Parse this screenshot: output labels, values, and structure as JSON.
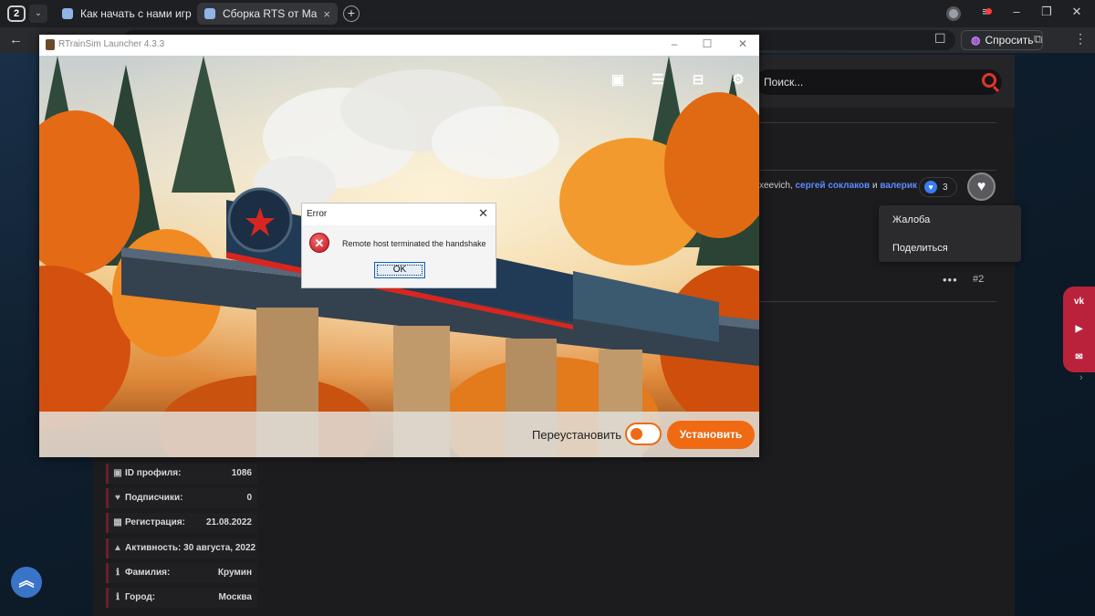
{
  "browser": {
    "tab_count": "2",
    "tabs": [
      {
        "label": "Как начать с нами играть"
      },
      {
        "label": "Сборка RTS от MaDaDe"
      }
    ],
    "ask_label": "Спросить"
  },
  "site": {
    "search_placeholder": "Поиск...",
    "likers": {
      "prefix": "xeevich, ",
      "user1": "сергей соклаков",
      "and": " и ",
      "user2": "валерик"
    },
    "like_count": "3",
    "menu_items": [
      "Жалоба",
      "Поделиться"
    ],
    "post_number": "#2",
    "social": [
      "vk-icon",
      "youtube-icon",
      "mail-icon"
    ],
    "profile_stats": [
      {
        "icon": "id-card-icon",
        "glyph": "▣",
        "label": "ID профиля:",
        "value": "1086"
      },
      {
        "icon": "heart-icon",
        "glyph": "♥",
        "label": "Подписчики:",
        "value": "0"
      },
      {
        "icon": "calendar-icon",
        "glyph": "▦",
        "label": "Регистрация:",
        "value": "21.08.2022"
      },
      {
        "icon": "bell-icon",
        "glyph": "▲",
        "label": "Активность: 30 августа, 2022",
        "value": ""
      },
      {
        "icon": "info-icon",
        "glyph": "ℹ",
        "label": "Фамилия:",
        "value": "Крумин"
      },
      {
        "icon": "info-icon",
        "glyph": "ℹ",
        "label": "Город:",
        "value": "Москва"
      }
    ]
  },
  "launcher": {
    "title": "RTrainSim Launcher 4.3.3",
    "top_icons": [
      "profile-icon",
      "list-icon",
      "train-icon",
      "settings-icon"
    ],
    "reinstall_label": "Переустановить",
    "reinstall_enabled": false,
    "install_label": "Установить",
    "accent": "#ef6a12"
  },
  "dialog": {
    "title": "Error",
    "message": "Remote host terminated the handshake",
    "ok_label": "OK"
  }
}
